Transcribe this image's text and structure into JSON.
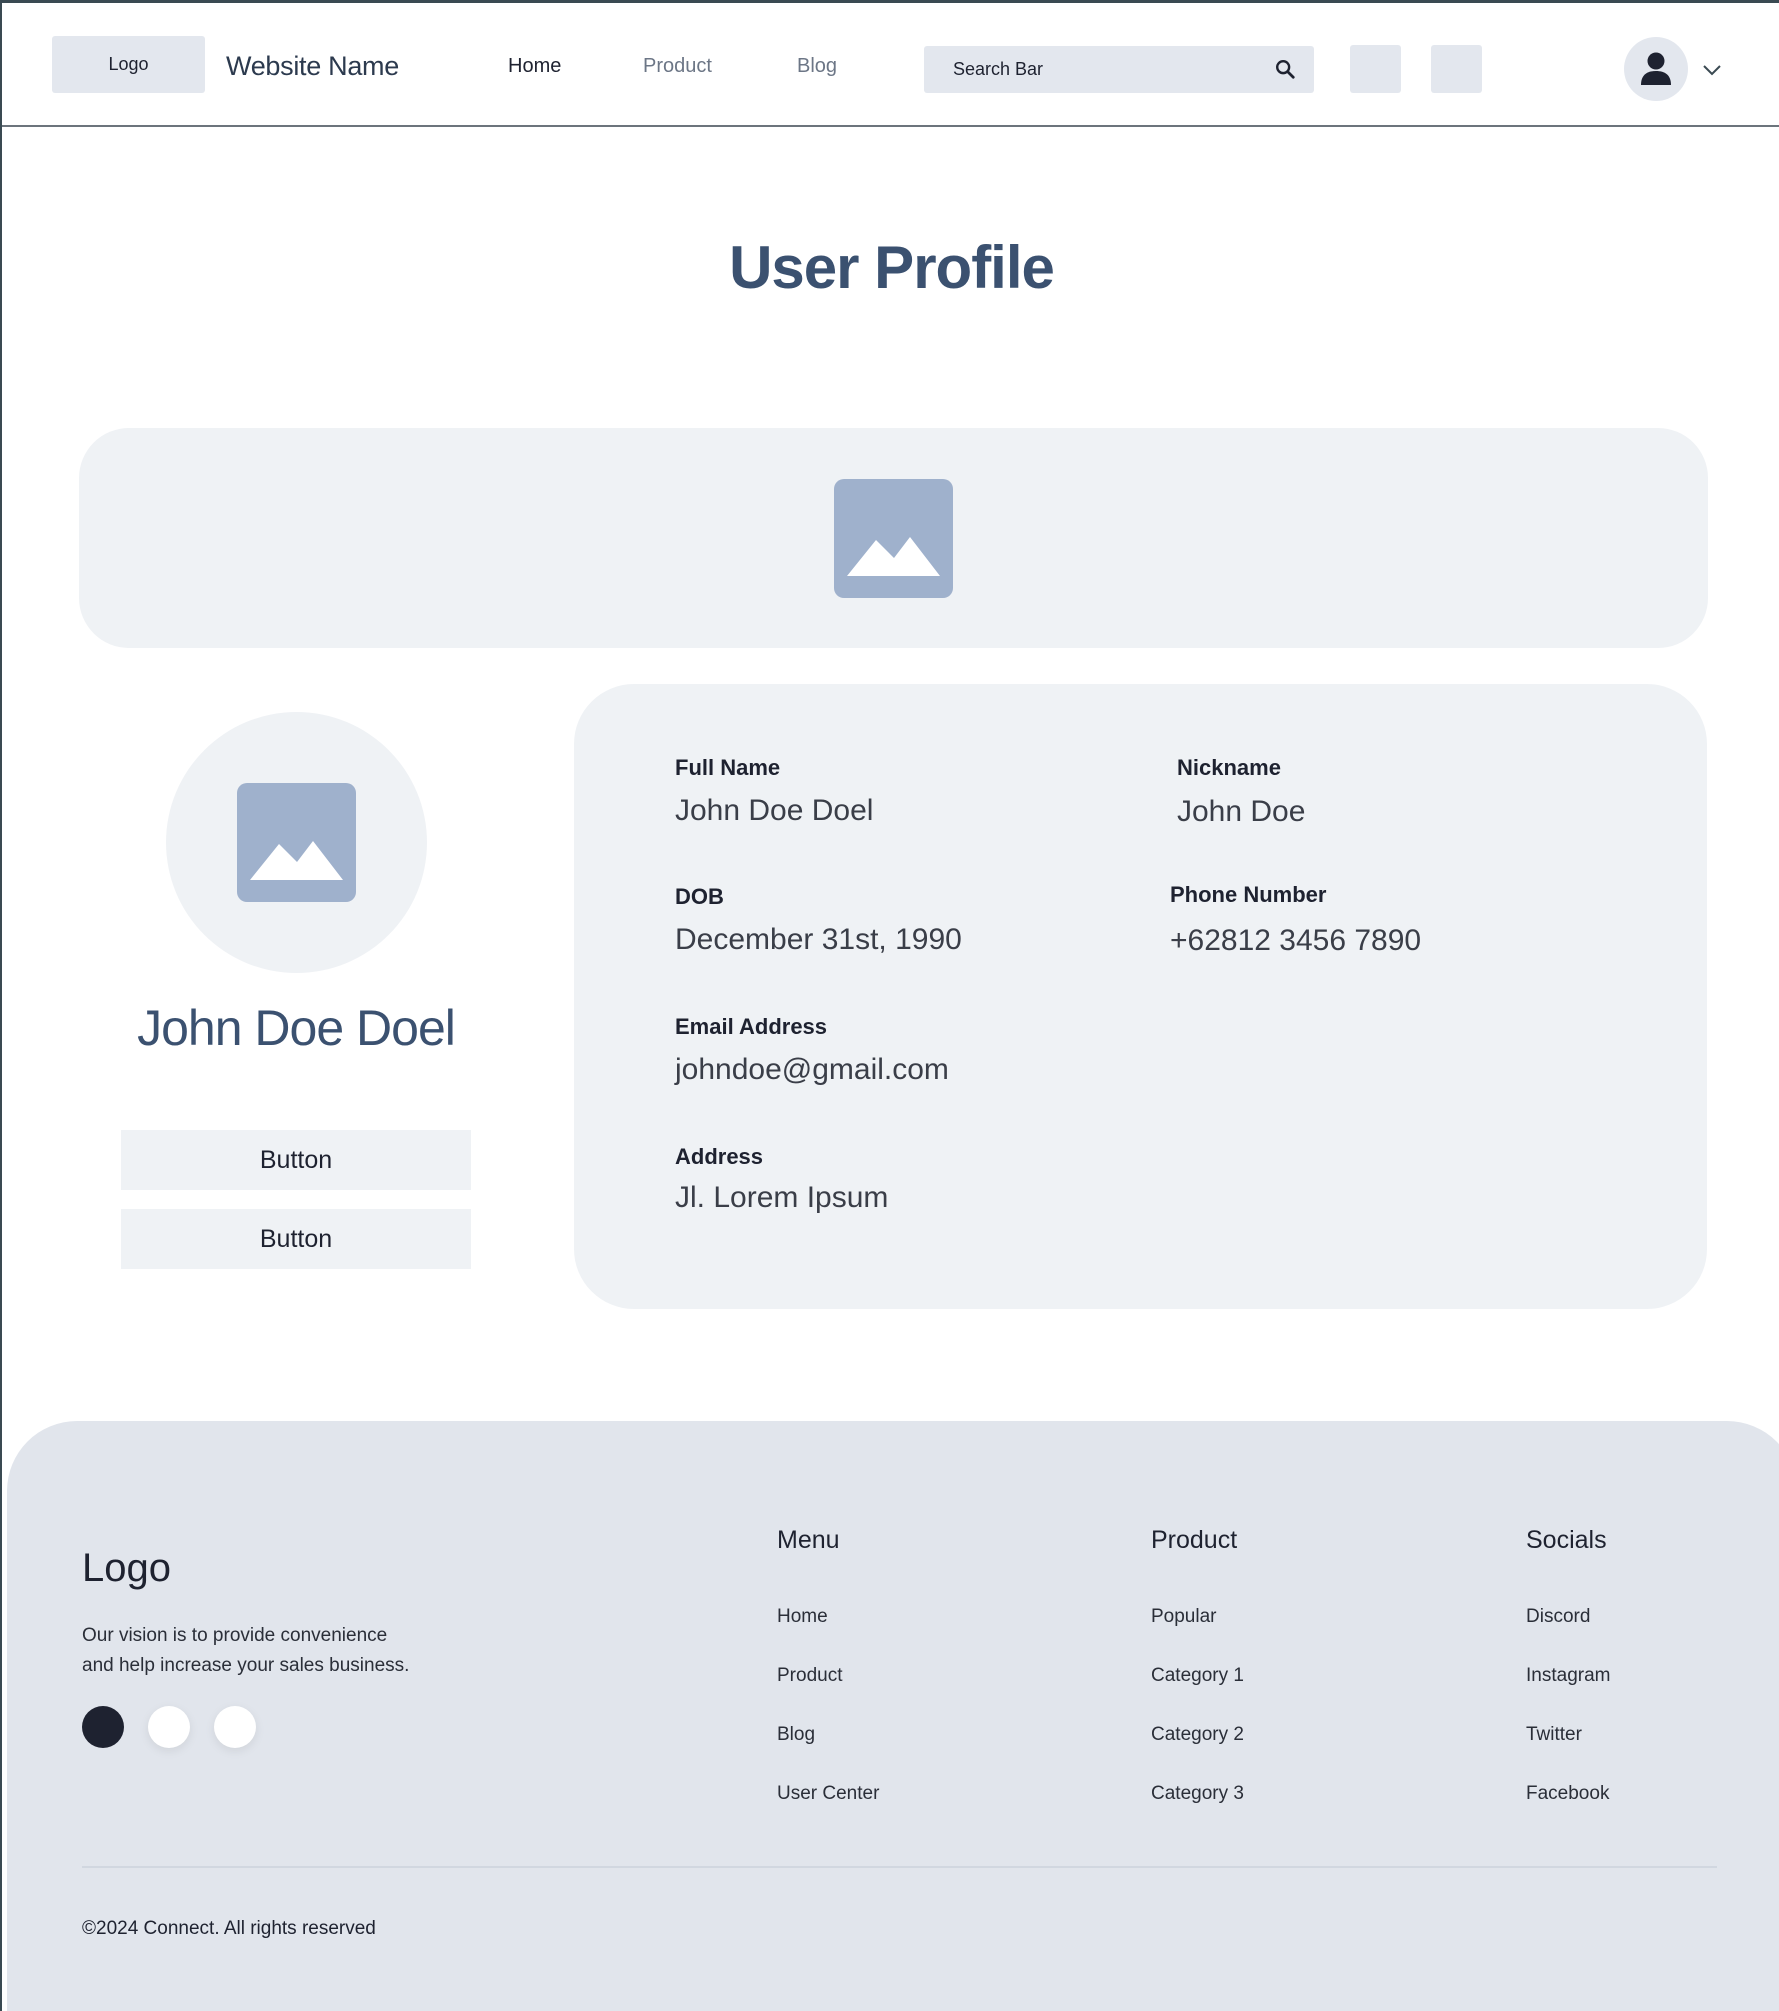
{
  "nav": {
    "logo": "Logo",
    "site_name": "Website Name",
    "links": [
      {
        "label": "Home",
        "active": true
      },
      {
        "label": "Product",
        "active": false
      },
      {
        "label": "Blog",
        "active": false
      }
    ],
    "search_placeholder": "Search Bar",
    "search_icon": "search-icon",
    "user_icon": "user-icon",
    "dropdown_icon": "chevron-down-icon"
  },
  "page": {
    "title": "User Profile"
  },
  "banner": {
    "icon": "image-placeholder-icon"
  },
  "profile": {
    "name": "John Doe Doel",
    "buttons": [
      "Button",
      "Button"
    ]
  },
  "info": {
    "full_name_label": "Full Name",
    "full_name": "John Doe Doel",
    "nickname_label": "Nickname",
    "nickname": "John Doe",
    "dob_label": "DOB",
    "dob": "December 31st, 1990",
    "phone_label": "Phone Number",
    "phone": "+62812 3456 7890",
    "email_label": "Email Address",
    "email": "johndoe@gmail.com",
    "address_label": "Address",
    "address": "Jl. Lorem Ipsum"
  },
  "footer": {
    "logo": "Logo",
    "vision_line1": "Our vision is to provide convenience",
    "vision_line2": "and help increase your sales business.",
    "dots": [
      "#1e2230",
      "#ffffff",
      "#ffffff"
    ],
    "columns": [
      {
        "heading": "Menu",
        "items": [
          "Home",
          "Product",
          "Blog",
          "User Center"
        ]
      },
      {
        "heading": "Product",
        "items": [
          "Popular",
          "Category 1",
          "Category 2",
          "Category 3"
        ]
      },
      {
        "heading": "Socials",
        "items": [
          "Discord",
          "Instagram",
          "Twitter",
          "Facebook"
        ]
      }
    ],
    "copyright": "©2024 Connect. All rights reserved"
  },
  "colors": {
    "accent": "#3b5170",
    "placeholder": "#9fb1cc",
    "card_bg": "#eff2f5",
    "footer_bg": "#e1e5ec"
  }
}
